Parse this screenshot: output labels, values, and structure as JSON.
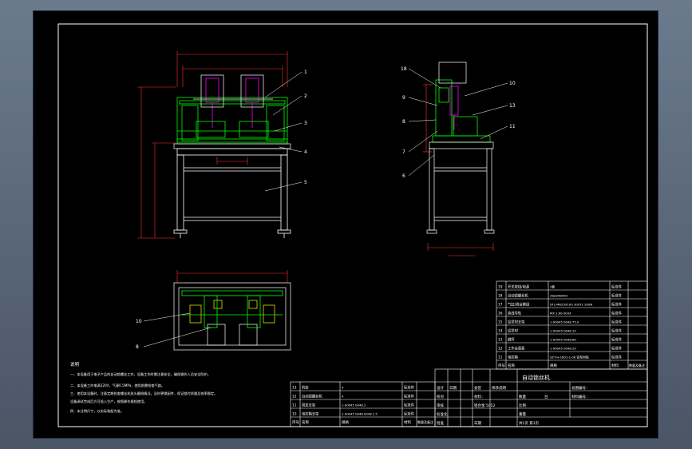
{
  "title_block": {
    "title": "自动锁丝机",
    "drawing_no_label": "总图编号：",
    "material_no_label": "材料编号：",
    "rows": [
      {
        "a": "设计",
        "b": "日期",
        "c": "会签",
        "d": "修改说明"
      },
      {
        "a": "校对",
        "b": "",
        "c": "材料：",
        "d": ""
      },
      {
        "a": "审核",
        "b": "",
        "c": "",
        "d": ""
      },
      {
        "a": "标准化",
        "b": "",
        "c": "",
        "d": ""
      },
      {
        "a": "批准",
        "b": "",
        "c": "铝合金 5052",
        "d": ""
      }
    ],
    "scale_labels": [
      "数量",
      "比例",
      "重量",
      "台"
    ],
    "sheet": "共1页 第1页",
    "date_label": "日期"
  },
  "parts_upper": {
    "header": [
      "序号",
      "名称",
      "规格",
      "材料",
      "数量及备注"
    ],
    "rows": [
      {
        "no": "19",
        "name": "开关按钮/电源",
        "spec": "3套",
        "mat": "标准件"
      },
      {
        "no": "18",
        "name": "自动锁螺丝机",
        "spec": "ZSJ-B58000",
        "mat": "标准件"
      },
      {
        "no": "17",
        "name": "气缸/滑台模组",
        "spec": "STL-MR25X100 300T1 200N",
        "mat": "标准件"
      },
      {
        "no": "16",
        "name": "直线导轨",
        "spec": "MX 1.60 0043",
        "mat": "标准件"
      },
      {
        "no": "15",
        "name": "铝型材支架",
        "spec": "1-90045 0048.75.0",
        "mat": "标准件"
      },
      {
        "no": "14",
        "name": "铝型材",
        "spec": "1-90045 0048.10",
        "mat": "标准件"
      },
      {
        "no": "13",
        "name": "脚杯",
        "spec": "1-90045 0048.80",
        "mat": "标准件"
      },
      {
        "no": "12",
        "name": "工作台面板",
        "spec": "1-90045 0048.20",
        "mat": "标准件"
      },
      {
        "no": "11",
        "name": "电控箱",
        "spec": "SZT-H-1801-1-06 铝型材组",
        "mat": "标准件"
      }
    ]
  },
  "parts_lower": {
    "rows": [
      {
        "no": "13",
        "name": "机架",
        "spec": "4",
        "mat": "标准件"
      },
      {
        "no": "12",
        "name": "自动锁螺丝机",
        "spec": "4",
        "mat": "标准件"
      },
      {
        "no": "11",
        "name": "固定支架",
        "spec": "1-90045 0048.2",
        "mat": "标准件"
      },
      {
        "no": "10",
        "name": "电控箱支架",
        "spec": "1-90045 0048.0048.1.5",
        "mat": "标准件"
      }
    ],
    "header": [
      "序号",
      "名称",
      "规格",
      "材料",
      "数量及备注"
    ]
  },
  "notes": {
    "heading": "说明",
    "lines": [
      "一、本设备用于电子产品的自动锁螺丝工作，设备工作时需注意安全，确保操作人员安全防护。",
      "二、本设备工作电源220V，气源0.5MPa，使用前需检查气路。",
      "三、使用本设备时，注意定期检查螺丝机批头磨损情况，及时更换配件，保证锁付质量及效率稳定。",
      "    设备调试完成后方可投入生产，按照操作规程使用。",
      "四、未注明尺寸，以实际装配为准。"
    ]
  },
  "balloons_front": [
    "1",
    "2",
    "3",
    "4",
    "5"
  ],
  "balloons_side": [
    "18",
    "9",
    "8",
    "7",
    "6",
    "10",
    "13",
    "11"
  ],
  "balloons_top": [
    "10",
    "8"
  ],
  "colors": {
    "background": "#000000",
    "line_white": "#ffffff",
    "line_green": "#00ff00",
    "line_magenta": "#ff00ff",
    "line_yellow": "#ffff00",
    "line_cyan": "#00ffff",
    "dim_red": "#ff3030"
  }
}
